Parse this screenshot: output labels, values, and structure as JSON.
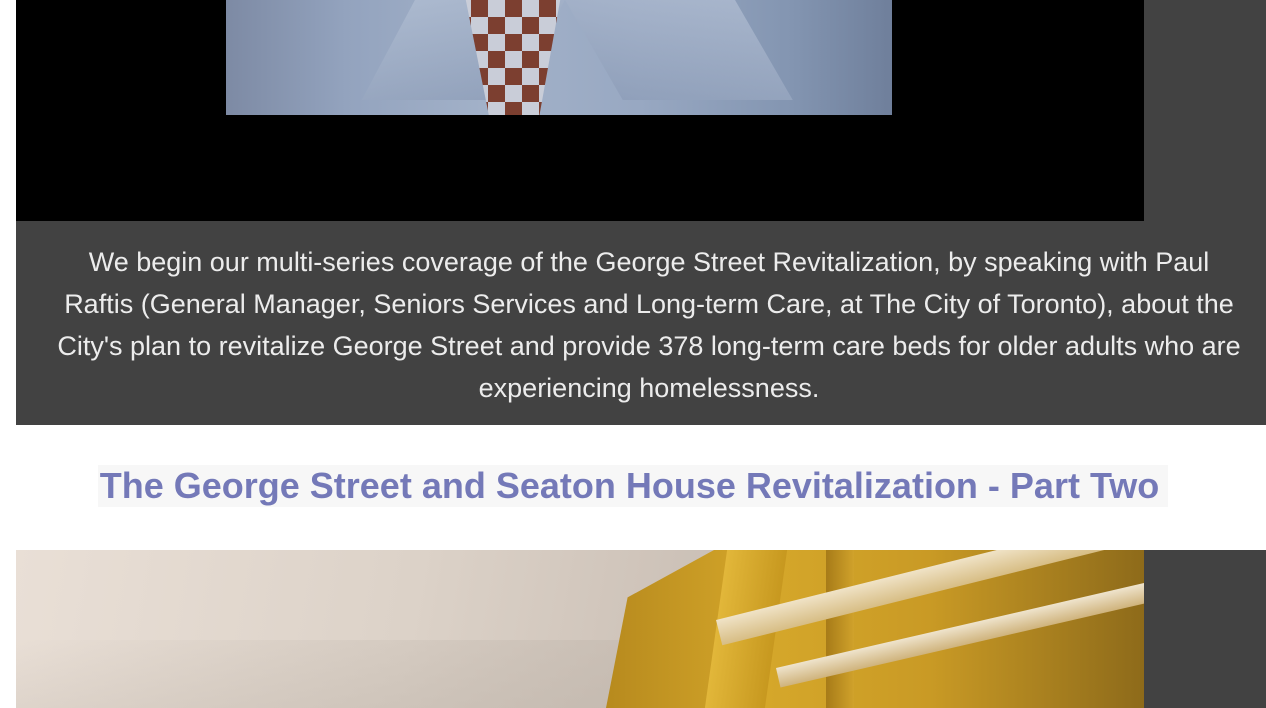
{
  "caption": {
    "text": "We begin our multi-series coverage of the George Street Revitalization, by speaking with Paul Raftis (General Manager, Seniors Services and Long-term Care, at The City of Toronto), about the City's plan to revitalize George Street and provide 378 long-term care beds for  older adults who are experiencing homelessness."
  },
  "section": {
    "heading": "The George Street and Seaton House Revitalization - Part Two"
  },
  "colors": {
    "caption_background": "#424242",
    "caption_text": "#ececec",
    "heading_text": "#7479b8",
    "heading_background": "#f7f7f7",
    "video_letterbox": "#000000"
  }
}
